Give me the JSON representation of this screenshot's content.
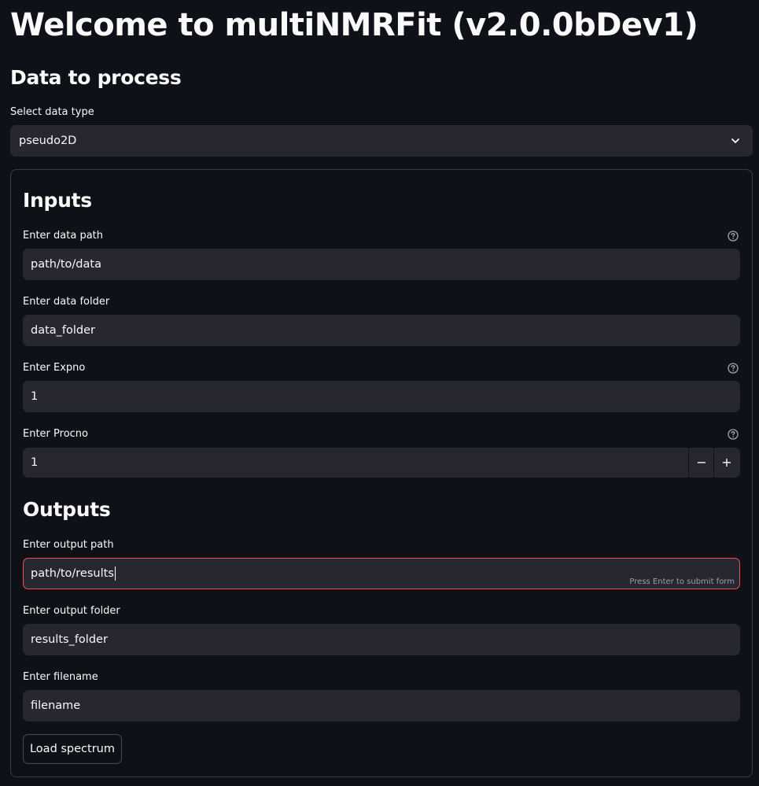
{
  "app": {
    "title": "Welcome to multiNMRFit (v2.0.0bDev1)"
  },
  "data_section": {
    "header": "Data to process",
    "data_type": {
      "label": "Select data type",
      "value": "pseudo2D"
    }
  },
  "inputs": {
    "header": "Inputs",
    "data_path": {
      "label": "Enter data path",
      "value": "path/to/data"
    },
    "data_folder": {
      "label": "Enter data folder",
      "value": "data_folder"
    },
    "expno": {
      "label": "Enter Expno",
      "value": "1"
    },
    "procno": {
      "label": "Enter Procno",
      "value": "1",
      "minus": "−",
      "plus": "+"
    }
  },
  "outputs": {
    "header": "Outputs",
    "output_path": {
      "label": "Enter output path",
      "value": "path/to/results",
      "hint": "Press Enter to submit form"
    },
    "output_folder": {
      "label": "Enter output folder",
      "value": "results_folder"
    },
    "filename": {
      "label": "Enter filename",
      "value": "filename"
    }
  },
  "load_button": "Load spectrum",
  "colors": {
    "background": "#0e1117",
    "input_bg": "#262730",
    "focus": "#ff4b4b",
    "text": "#fafafa"
  },
  "icons": {
    "select": "chevron-down-icon",
    "help": "question-circle-icon"
  }
}
